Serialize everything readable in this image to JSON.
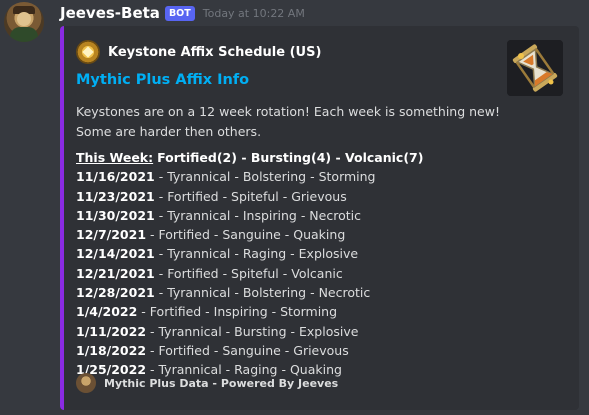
{
  "message": {
    "username": "Jeeves-Beta",
    "badge": "BOT",
    "timestamp": "Today at 10:22 AM"
  },
  "embed": {
    "accent_color": "#8a2be2",
    "author": {
      "name": "Keystone Affix Schedule (US)",
      "icon": "keystone-icon"
    },
    "title": "Mythic Plus Affix Info",
    "title_color": "#00aff4",
    "thumbnail": "hourglass-keystone-image",
    "description_lines": [
      "Keystones are on a 12 week rotation! Each week is something new!",
      "Some are harder then others."
    ],
    "this_week": {
      "label": "This Week:",
      "value": "Fortified(2) - Bursting(4) - Volcanic(7)"
    },
    "schedule": [
      {
        "date": "11/16/2021",
        "affixes": "Tyrannical - Bolstering - Storming"
      },
      {
        "date": "11/23/2021",
        "affixes": "Fortified - Spiteful - Grievous"
      },
      {
        "date": "11/30/2021",
        "affixes": "Tyrannical - Inspiring - Necrotic"
      },
      {
        "date": "12/7/2021",
        "affixes": "Fortified - Sanguine - Quaking"
      },
      {
        "date": "12/14/2021",
        "affixes": "Tyrannical - Raging - Explosive"
      },
      {
        "date": "12/21/2021",
        "affixes": "Fortified - Spiteful - Volcanic"
      },
      {
        "date": "12/28/2021",
        "affixes": "Tyrannical - Bolstering - Necrotic"
      },
      {
        "date": "1/4/2022",
        "affixes": "Fortified - Inspiring - Storming"
      },
      {
        "date": "1/11/2022",
        "affixes": "Tyrannical - Bursting - Explosive"
      },
      {
        "date": "1/18/2022",
        "affixes": "Fortified - Sanguine - Grievous"
      },
      {
        "date": "1/25/2022",
        "affixes": "Tyrannical - Raging - Quaking"
      }
    ],
    "footer": {
      "text": "Mythic Plus Data - Powered By Jeeves",
      "icon": "jeeves-avatar-icon"
    }
  }
}
